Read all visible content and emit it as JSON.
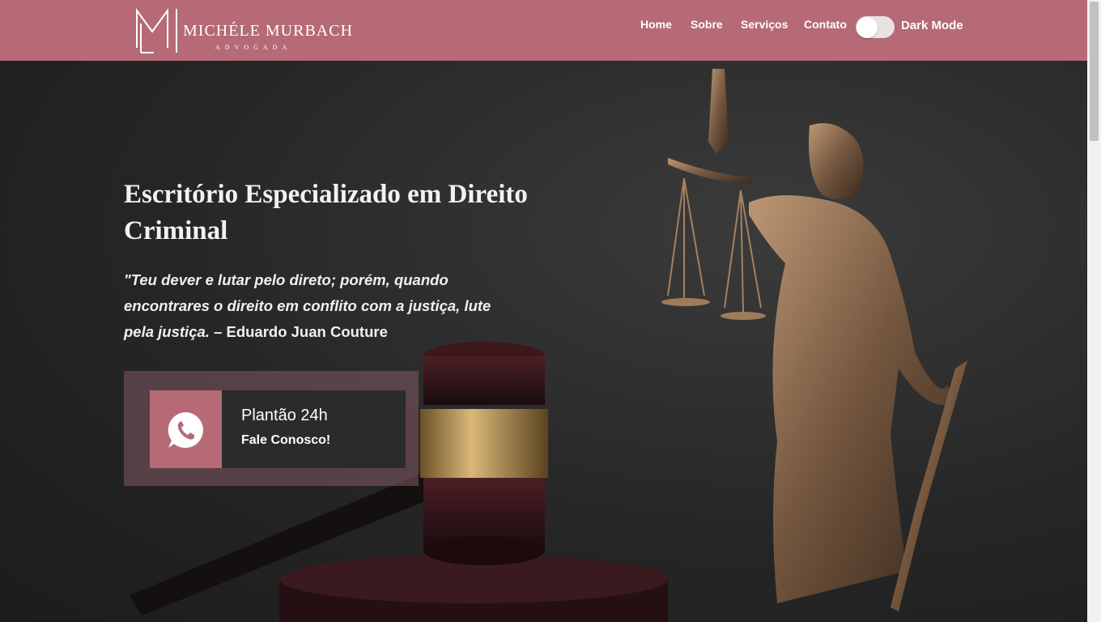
{
  "brand": {
    "name": "MICHÉLE MURBACH",
    "subtitle": "ADVOGADA",
    "color": "#b56a76"
  },
  "nav": {
    "items": [
      "Home",
      "Sobre",
      "Serviços",
      "Contato"
    ],
    "dark_mode_label": "Dark Mode",
    "dark_mode_on": false
  },
  "hero": {
    "headline": "Escritório Especializado em Direito Criminal",
    "quote": "\"Teu dever e lutar pelo direto; porém, quando encontrares o direito em conflito com a justiça, lute pela justiça.",
    "quote_author": "– Eduardo Juan Couture",
    "background": "justice statue and judge gavel photo"
  },
  "cta": {
    "icon": "whatsapp-icon",
    "title": "Plantão 24h",
    "subtitle": "Fale Conosco!"
  }
}
